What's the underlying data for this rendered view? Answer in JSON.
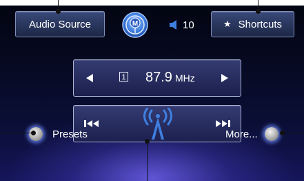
{
  "top_bar": {
    "audio_source_label": "Audio Source",
    "shortcuts_label": "Shortcuts",
    "shortcuts_icon": "★",
    "mode_icon": "fm-mode-icon",
    "volume": "10"
  },
  "tuner": {
    "preset_number": "1",
    "frequency": "87.9",
    "unit": "MHz",
    "left_arrow_icon": "triangle-left",
    "right_arrow_icon": "triangle-right"
  },
  "seek": {
    "back_icon": "skip-back",
    "forward_icon": "skip-forward",
    "center_icon": "antenna-signal"
  },
  "bottom": {
    "presets_label": "Presets",
    "more_label": "More..."
  },
  "colors": {
    "background_top": "#030512",
    "background_glow": "#6c60eb",
    "button_border": "#7f8fbd",
    "text": "#ffffff",
    "icon_blue": "#3f7fe0"
  }
}
